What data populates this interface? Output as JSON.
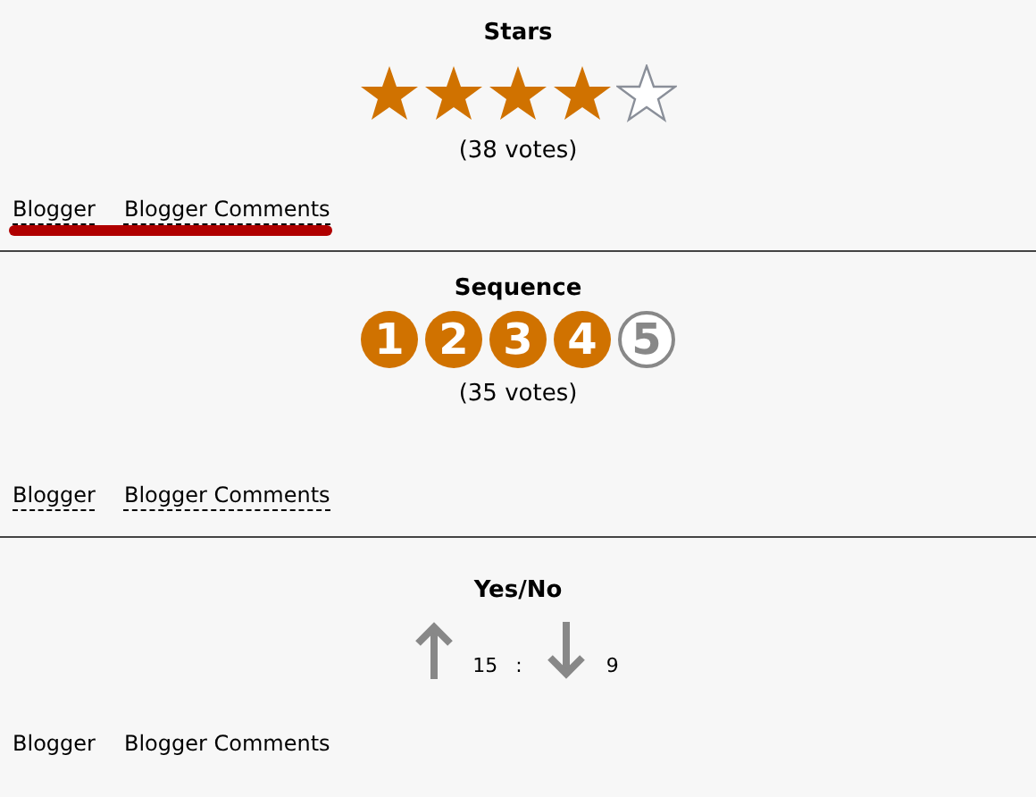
{
  "sections": [
    {
      "kind": "stars",
      "title": "Stars",
      "stars": 4,
      "votes": "(38 votes)",
      "links": [
        {
          "label": "Blogger",
          "underlined": true
        },
        {
          "label": "Blogger Comments",
          "underlined": true
        }
      ],
      "highlighted": true
    },
    {
      "kind": "sequence",
      "title": "Sequence",
      "items": [
        {
          "label": "1",
          "filled": true
        },
        {
          "label": "2",
          "filled": true
        },
        {
          "label": "3",
          "filled": true
        },
        {
          "label": "4",
          "filled": true
        },
        {
          "label": "5",
          "filled": false
        }
      ],
      "votes": "(35 votes)",
      "links": [
        {
          "label": "Blogger",
          "underlined": true
        },
        {
          "label": "Blogger Comments",
          "underlined": true
        }
      ],
      "highlighted": false
    },
    {
      "kind": "yesno",
      "title": "Yes/No",
      "yes": "15",
      "separator": ":",
      "no": "9",
      "links": [
        {
          "label": "Blogger",
          "underlined": false
        },
        {
          "label": "Blogger Comments",
          "underlined": false
        }
      ],
      "highlighted": false
    }
  ]
}
